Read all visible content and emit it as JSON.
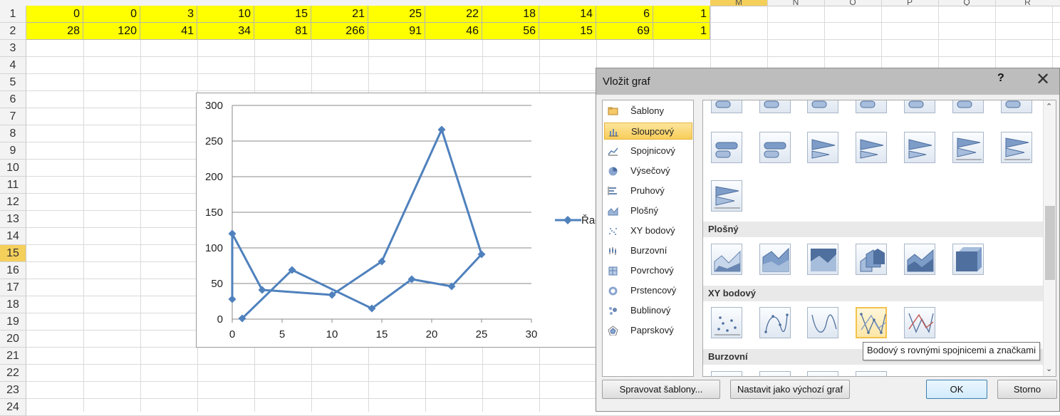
{
  "spreadsheet": {
    "visible_col_letters": [
      "M",
      "N",
      "O",
      "P",
      "Q",
      "R"
    ],
    "row_numbers": [
      "1",
      "2",
      "3",
      "4",
      "5",
      "6",
      "7",
      "8",
      "9",
      "10",
      "11",
      "12",
      "13",
      "14",
      "15",
      "16",
      "17",
      "18",
      "19",
      "20",
      "21",
      "22",
      "23",
      "24"
    ],
    "selected_row": "15",
    "selected_col": "M",
    "row1": [
      "0",
      "0",
      "3",
      "10",
      "15",
      "21",
      "25",
      "22",
      "18",
      "14",
      "6",
      "1"
    ],
    "row2": [
      "28",
      "120",
      "41",
      "34",
      "81",
      "266",
      "91",
      "46",
      "56",
      "15",
      "69",
      "1"
    ],
    "highlight_color": "#ffff00"
  },
  "chart": {
    "legend_label": "Řad",
    "series_color": "#4f81bd",
    "chart_data": {
      "type": "scatter",
      "line": true,
      "markers": "diamond",
      "x": [
        0,
        0,
        3,
        10,
        15,
        21,
        25,
        22,
        18,
        14,
        6,
        1
      ],
      "y": [
        28,
        120,
        41,
        34,
        81,
        266,
        91,
        46,
        56,
        15,
        69,
        1
      ],
      "xlim": [
        0,
        30
      ],
      "ylim": [
        0,
        300
      ],
      "x_ticks": [
        "0",
        "5",
        "10",
        "15",
        "20",
        "25",
        "30"
      ],
      "y_ticks": [
        "0",
        "50",
        "100",
        "150",
        "200",
        "250",
        "300"
      ],
      "grid": true,
      "legend": "right"
    }
  },
  "dialog": {
    "title": "Vložit graf",
    "help": "?",
    "close": "✕",
    "categories": [
      {
        "label": "Šablony",
        "icon": "folder-icon"
      },
      {
        "label": "Sloupcový",
        "icon": "column-chart-icon",
        "selected": true
      },
      {
        "label": "Spojnicový",
        "icon": "line-chart-icon"
      },
      {
        "label": "Výsečový",
        "icon": "pie-chart-icon"
      },
      {
        "label": "Pruhový",
        "icon": "bar-chart-icon"
      },
      {
        "label": "Plošný",
        "icon": "area-chart-icon"
      },
      {
        "label": "XY bodový",
        "icon": "scatter-chart-icon"
      },
      {
        "label": "Burzovní",
        "icon": "stock-chart-icon"
      },
      {
        "label": "Povrchový",
        "icon": "surface-chart-icon"
      },
      {
        "label": "Prstencový",
        "icon": "doughnut-chart-icon"
      },
      {
        "label": "Bublinový",
        "icon": "bubble-chart-icon"
      },
      {
        "label": "Paprskový",
        "icon": "radar-chart-icon"
      }
    ],
    "sections": {
      "area": "Plošný",
      "scatter": "XY bodový",
      "stock": "Burzovní"
    },
    "tooltip": "Bodový s rovnými spojnicemi a značkami",
    "buttons": {
      "manage_templates": "Spravovat šablony...",
      "set_default": "Nastavit jako výchozí graf",
      "ok": "OK",
      "cancel": "Storno"
    },
    "scroll_up": "⌃",
    "scroll_down": "⌄"
  }
}
